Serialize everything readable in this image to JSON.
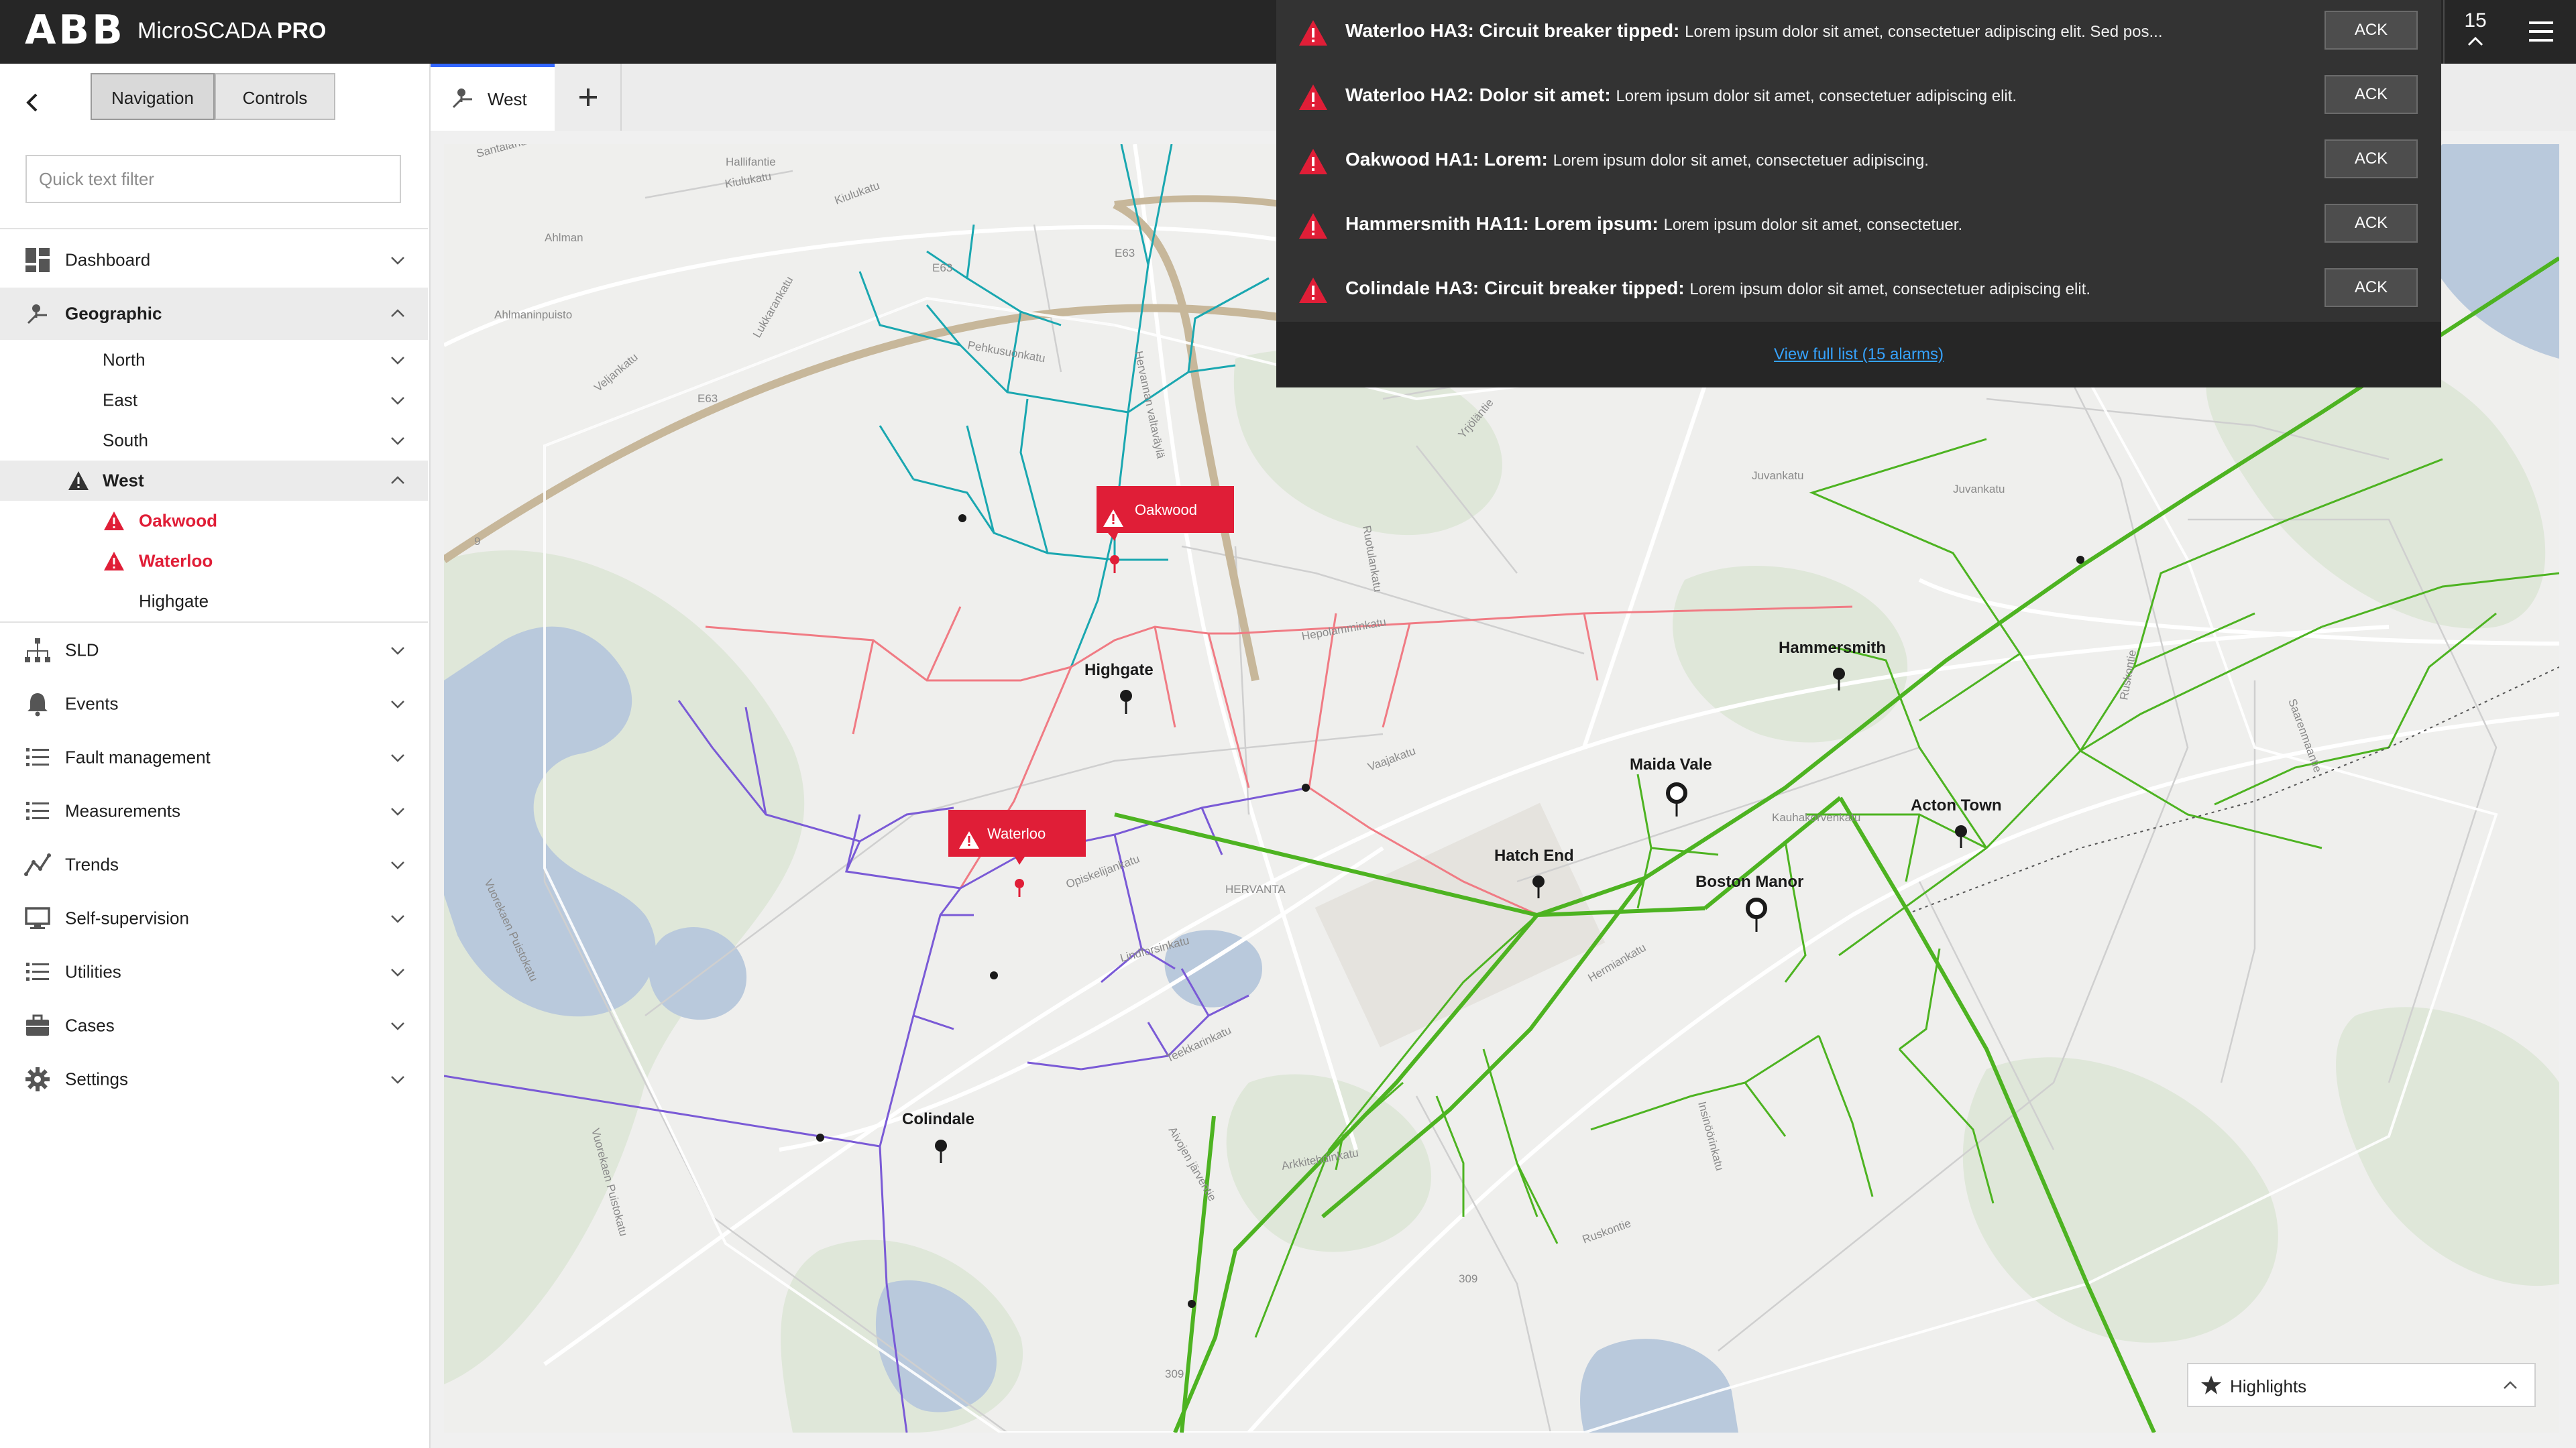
{
  "app": {
    "logo": "ABB",
    "name_prefix": "MicroSCADA ",
    "name_suffix": "PRO"
  },
  "alarms": {
    "count": "15",
    "items": [
      {
        "title": "Waterloo HA3: Circuit breaker tipped:",
        "desc": "Lorem ipsum dolor sit amet, consectetuer adipiscing elit. Sed pos...",
        "ack": "ACK"
      },
      {
        "title": "Waterloo HA2: Dolor sit amet:",
        "desc": "Lorem ipsum dolor sit amet, consectetuer adipiscing elit.",
        "ack": "ACK"
      },
      {
        "title": "Oakwood HA1: Lorem:",
        "desc": "Lorem ipsum dolor sit amet, consectetuer adipiscing.",
        "ack": "ACK"
      },
      {
        "title": "Hammersmith HA11: Lorem ipsum:",
        "desc": "Lorem ipsum dolor sit amet, consectetuer.",
        "ack": "ACK"
      },
      {
        "title": "Colindale HA3: Circuit breaker tipped:",
        "desc": "Lorem ipsum dolor sit amet, consectetuer adipiscing elit.",
        "ack": "ACK"
      }
    ],
    "view_full": "View full list (15 alarms)"
  },
  "sidebar": {
    "seg_navigation": "Navigation",
    "seg_controls": "Controls",
    "filter_placeholder": "Quick text filter",
    "dashboard": "Dashboard",
    "geographic": "Geographic",
    "north": "North",
    "east": "East",
    "south": "South",
    "west": "West",
    "oakwood": "Oakwood",
    "waterloo": "Waterloo",
    "highgate": "Highgate",
    "sld": "SLD",
    "events": "Events",
    "fault_management": "Fault management",
    "measurements": "Measurements",
    "trends": "Trends",
    "self_supervision": "Self-supervision",
    "utilities": "Utilities",
    "cases": "Cases",
    "settings": "Settings"
  },
  "tabs": {
    "west": "West",
    "add": "+"
  },
  "map": {
    "stations": {
      "highgate": "Highgate",
      "colindale": "Colindale",
      "hatch_end": "Hatch End",
      "maida_vale": "Maida Vale",
      "boston_manor": "Boston Manor",
      "acton_town": "Acton Town",
      "hammersmith": "Hammersmith"
    },
    "callouts": {
      "oakwood": "Oakwood",
      "waterloo": "Waterloo"
    },
    "streets": {
      "s1": "Santalahdenkatu",
      "s2": "Hallifantie",
      "s3": "Kiulukatu",
      "s4": "Kiulukatu",
      "s5": "Ahlman",
      "s6": "Ahlmaninpuisto",
      "s7": "Lukkarankatu",
      "s8": "Veljankatu",
      "s9": "Pehkusuonkatu",
      "s10": "Hervannan valtaväylä",
      "s11": "Hepolamminkatu",
      "s12": "Juvankatu",
      "s13": "Juvankatu",
      "s14": "Opiskelijankatu",
      "s15": "Lindforsinkatu",
      "s16": "Teekkarinkatu",
      "s17": "Vaajakatu",
      "s18": "HERVANTA",
      "s19": "Kauhakorvenkatu",
      "s20": "Hermiankatu",
      "s21": "Insinöörinkatu",
      "s22": "Arkkitehdinkatu",
      "s23": "Ruskontie",
      "s24": "Vuorekaen Puistokatu",
      "s25": "Vuorekaen Puistokatu",
      "s26": "Ruotulankatu",
      "s27": "Saarenmaantie",
      "s28": "Ruskontie",
      "s29": "Aivojen järventie",
      "s30": "Yrjöläntie",
      "s31": "E63",
      "s32": "E63",
      "s33": "9",
      "s34": "E63",
      "s35": "309",
      "s36": "309"
    }
  },
  "highlights": {
    "label": "Highlights"
  },
  "colors": {
    "alarm_red": "#e01e37",
    "tab_accent": "#3366ff",
    "line_cyan": "#1aa7b0",
    "line_red": "#f07b84",
    "line_purple": "#7a5ad6",
    "line_green": "#4db321",
    "link_blue": "#36a3ff"
  }
}
